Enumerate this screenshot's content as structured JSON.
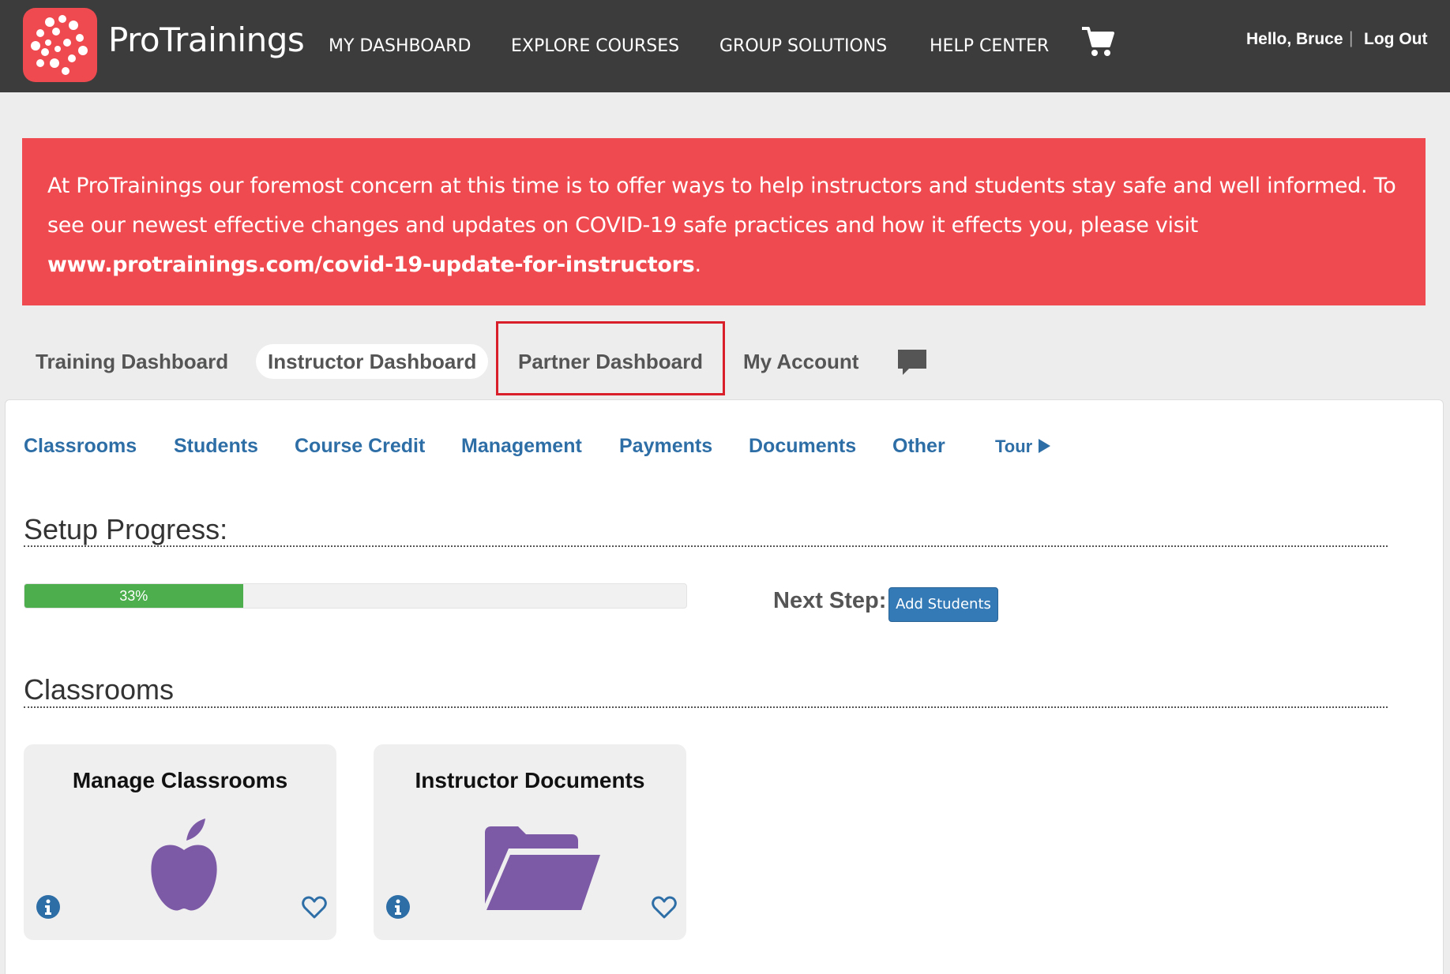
{
  "header": {
    "brand": "ProTrainings",
    "nav": [
      "MY DASHBOARD",
      "EXPLORE COURSES",
      "GROUP SOLUTIONS",
      "HELP CENTER"
    ],
    "greeting": "Hello, Bruce",
    "separator": "|",
    "logout": "Log Out"
  },
  "alert": {
    "text": "At ProTrainings our foremost concern at this time is to offer ways to help instructors and students stay safe and well informed. To see our newest effective changes and updates on COVID-19 safe practices and how it effects you, please visit ",
    "link": "www.protrainings.com/covid-19-update-for-instructors",
    "suffix": "."
  },
  "tabs": [
    "Training Dashboard",
    "Instructor Dashboard",
    "Partner Dashboard",
    "My Account"
  ],
  "subnav": {
    "items": [
      "Classrooms",
      "Students",
      "Course Credit",
      "Management",
      "Payments",
      "Documents",
      "Other"
    ],
    "tour": "Tour"
  },
  "setup": {
    "title": "Setup Progress:",
    "progress_label": "33%",
    "progress_value": 0.33,
    "next_step_label": "Next Step:",
    "next_step_button": "Add Students"
  },
  "classrooms": {
    "title": "Classrooms",
    "cards": [
      "Manage Classrooms",
      "Instructor Documents"
    ]
  },
  "colors": {
    "navbar": "#3c3c3c",
    "brand_red": "#ef4a4f",
    "link_blue": "#2e6ea6",
    "progress_green": "#4cae4c",
    "icon_purple": "#7c5aa6",
    "highlight_red": "#d9202a"
  },
  "icons": [
    "cart-icon",
    "chat-icon",
    "tour-arrow-icon",
    "apple-icon",
    "folder-icon",
    "info-icon",
    "heart-icon"
  ]
}
